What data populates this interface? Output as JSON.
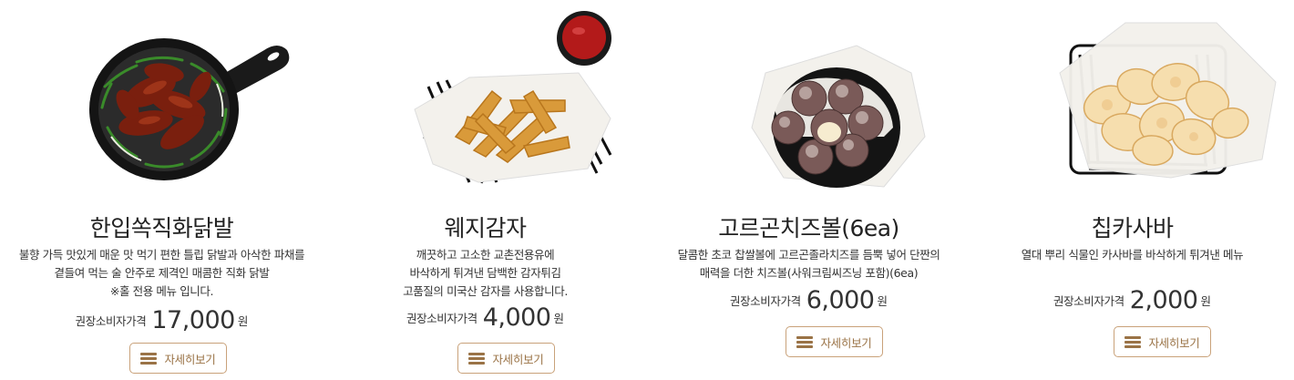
{
  "products": [
    {
      "name": "한입쏙직화닭발",
      "desc": [
        "불향 가득 맛있게 매운 맛 먹기 편한 틀립 닭발과 아삭한 파채를",
        "곁들여 먹는 술 안주로 제격인 매콤한 직화 닭발",
        "※홀 전용 메뉴 입니다."
      ],
      "price_label": "권장소비자가격",
      "price": "17,000",
      "unit": "원",
      "button": "자세히보기"
    },
    {
      "name": "웨지감자",
      "desc": [
        "깨끗하고 고소한 교촌전용유에",
        "바삭하게 튀겨낸 담백한 감자튀김",
        "고품질의 미국산 감자를 사용합니다."
      ],
      "price_label": "권장소비자가격",
      "price": "4,000",
      "unit": "원",
      "button": "자세히보기"
    },
    {
      "name": "고르곤치즈볼(6ea)",
      "desc": [
        "달콤한 초코 찹쌀볼에 고르곤졸라치즈를 듬뿍 넣어 단짠의",
        "매력을 더한 치즈볼(사워크림씨즈닝 포함)(6ea)"
      ],
      "price_label": "권장소비자가격",
      "price": "6,000",
      "unit": "원",
      "button": "자세히보기"
    },
    {
      "name": "칩카사바",
      "desc": [
        "열대 뿌리 식물인 카사바를 바삭하게 튀겨낸 메뉴"
      ],
      "price_label": "권장소비자가격",
      "price": "2,000",
      "unit": "원",
      "button": "자세히보기"
    }
  ],
  "icons": {
    "button_icon": "menu-lines-icon"
  },
  "colors": {
    "accent": "#9a7346",
    "button_border": "#c9a27a"
  }
}
